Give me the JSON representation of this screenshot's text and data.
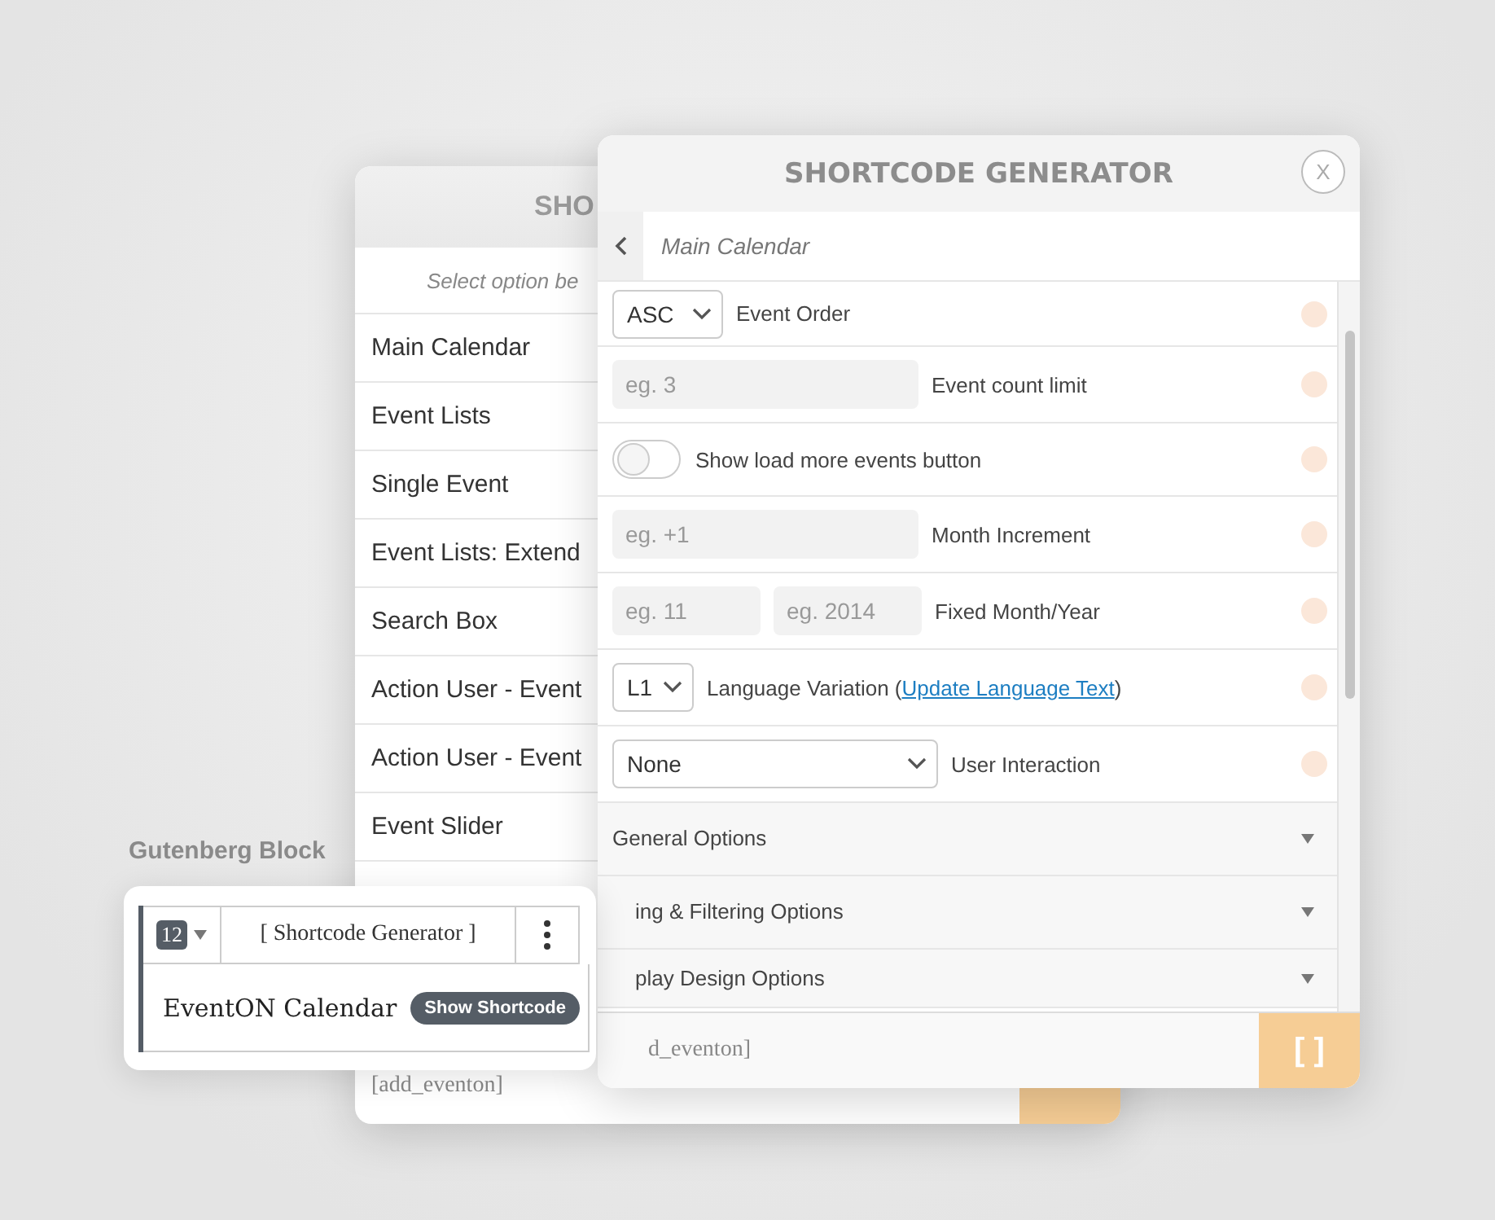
{
  "back_panel": {
    "title": "SHO",
    "hint": "Select option be",
    "items": [
      "Main Calendar",
      "Event Lists",
      "Single Event",
      "Event Lists: Extend",
      "Search Box",
      "Action User - Event",
      "Action User - Event",
      "Event Slider"
    ],
    "shortcode": "[add_eventon]"
  },
  "front_panel": {
    "title": "SHORTCODE GENERATOR",
    "close": "X",
    "breadcrumb": "Main Calendar",
    "rows": [
      {
        "kind": "select",
        "value": "ASC",
        "label": "Event Order"
      },
      {
        "kind": "input",
        "placeholder": "eg. 3",
        "label": "Event count limit"
      },
      {
        "kind": "toggle",
        "on": false,
        "label": "Show load more events button"
      },
      {
        "kind": "input",
        "placeholder": "eg. +1",
        "label": "Month Increment"
      },
      {
        "kind": "pair",
        "placeholders": [
          "eg. 11",
          "eg. 2014"
        ],
        "label": "Fixed Month/Year"
      },
      {
        "kind": "select",
        "value": "L1",
        "label": "Language Variation (",
        "link": "Update Language Text",
        "suffix": ")"
      },
      {
        "kind": "wide_select",
        "value": "None",
        "label": "User Interaction"
      }
    ],
    "sections": [
      {
        "label": "General Options",
        "expanded": false
      },
      {
        "label": "ing & Filtering Options",
        "expanded": false
      },
      {
        "label": "play Design Options",
        "expanded": false
      }
    ],
    "shortcode": "d_eventon]",
    "insert_button": "[ ]"
  },
  "gutenberg": {
    "label": "Gutenberg Block",
    "block_icon_text": "12",
    "toolbar_title": "[ Shortcode Generator ]",
    "block_title": "EventON Calendar",
    "button": "Show Shortcode"
  }
}
